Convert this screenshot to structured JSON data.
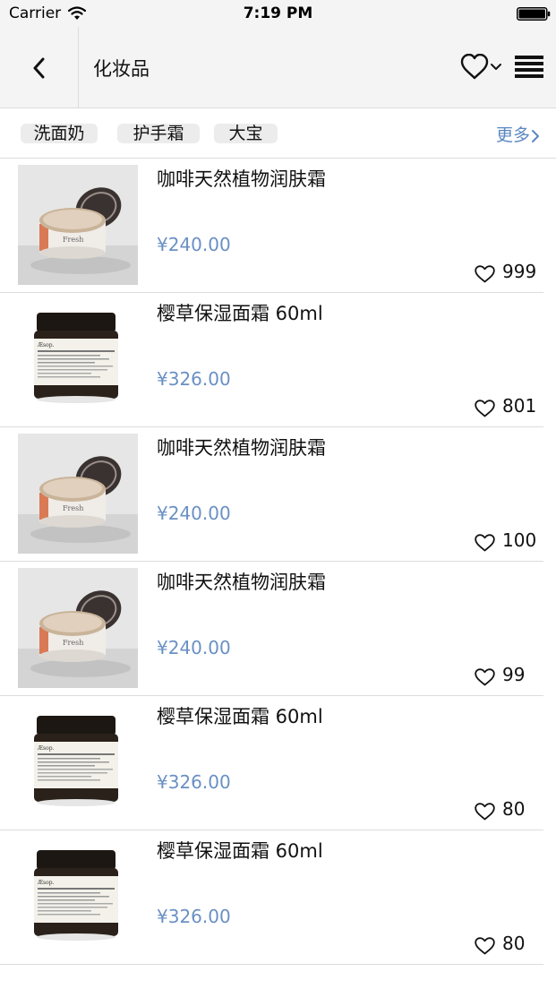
{
  "status_bar": {
    "carrier": "Carrier",
    "time": "7:19 PM"
  },
  "nav": {
    "title": "化妆品",
    "back_icon": "chevron-left-icon",
    "favorite_icon": "heart-outline-icon",
    "dropdown_icon": "chevron-down-icon",
    "menu_icon": "list-menu-icon"
  },
  "tags": {
    "items": [
      "洗面奶",
      "护手霜",
      "大宝"
    ],
    "more_label": "更多"
  },
  "colors": {
    "price": "#6a90c4",
    "more_link": "#5b86c1",
    "nav_background": "#f4f4f4",
    "tag_background": "#ececec"
  },
  "products": [
    {
      "name": "咖啡天然植物润肤霜",
      "price": "¥240.00",
      "likes": "999",
      "image": "cream-jar-open"
    },
    {
      "name": "樱草保湿面霜 60ml",
      "price": "¥326.00",
      "likes": "801",
      "image": "aesop-jar"
    },
    {
      "name": "咖啡天然植物润肤霜",
      "price": "¥240.00",
      "likes": "100",
      "image": "cream-jar-open"
    },
    {
      "name": "咖啡天然植物润肤霜",
      "price": "¥240.00",
      "likes": "99",
      "image": "cream-jar-open"
    },
    {
      "name": "樱草保湿面霜 60ml",
      "price": "¥326.00",
      "likes": "80",
      "image": "aesop-jar"
    },
    {
      "name": "樱草保湿面霜 60ml",
      "price": "¥326.00",
      "likes": "80",
      "image": "aesop-jar"
    }
  ]
}
